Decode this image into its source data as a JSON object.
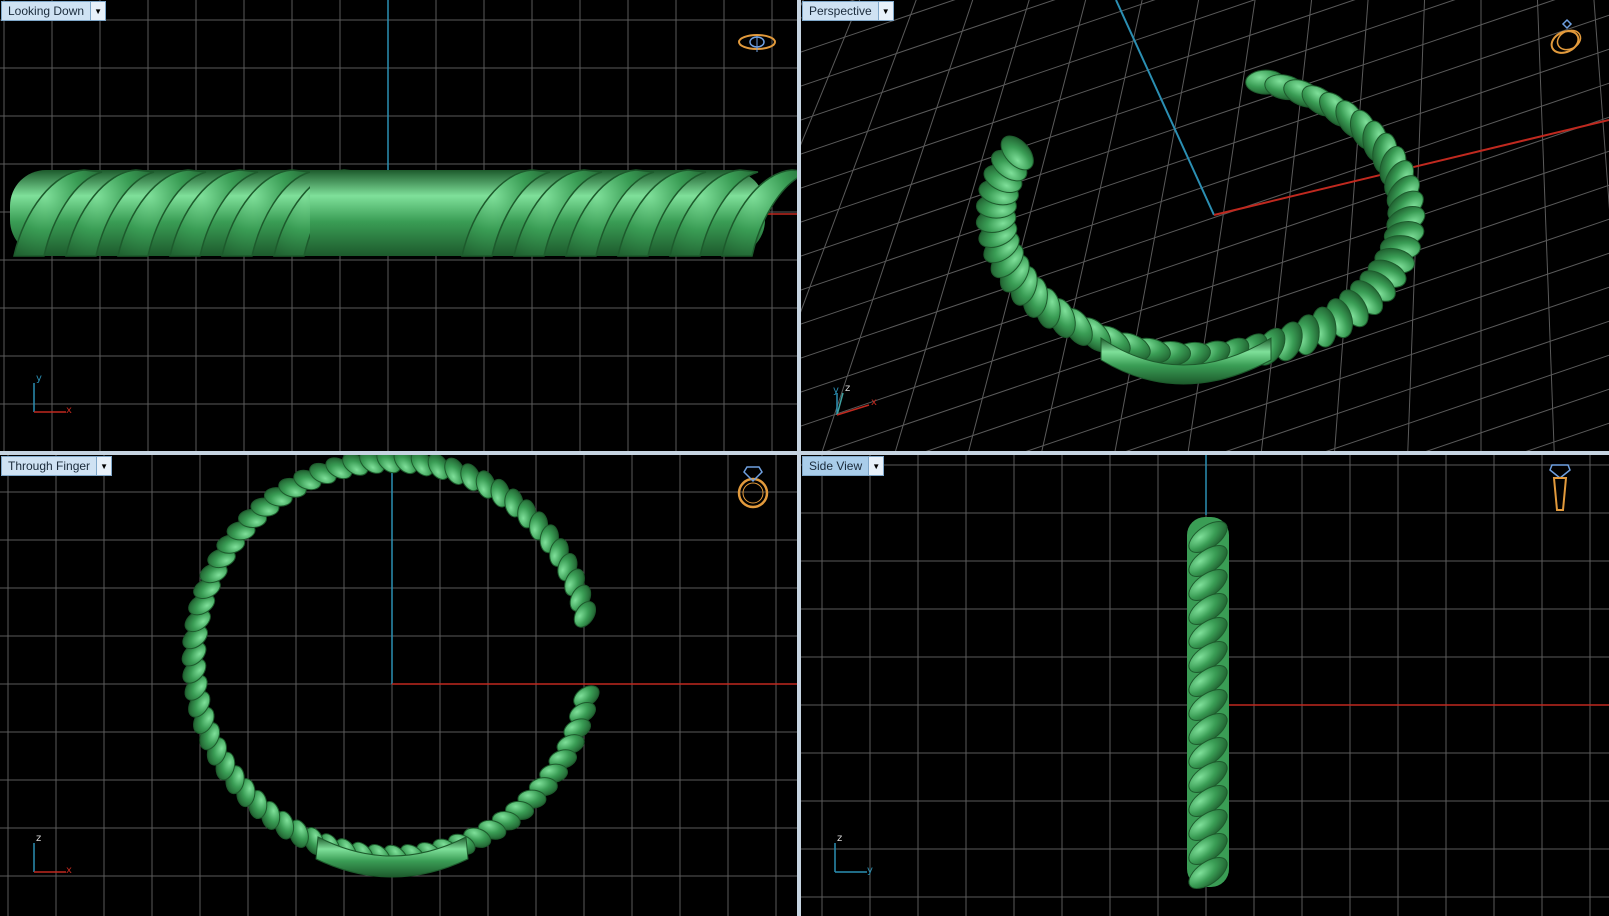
{
  "viewports": [
    {
      "id": "top",
      "label": "Looking Down",
      "axes": [
        "y",
        "x"
      ],
      "icon": "ring-top-view-icon"
    },
    {
      "id": "persp",
      "label": "Perspective",
      "axes": [
        "z",
        "y",
        "x"
      ],
      "icon": "ring-perspective-icon"
    },
    {
      "id": "front",
      "label": "Through Finger",
      "axes": [
        "z",
        "x"
      ],
      "icon": "ring-front-view-icon"
    },
    {
      "id": "side",
      "label": "Side View",
      "axes": [
        "z",
        "y"
      ],
      "icon": "ring-side-view-icon"
    }
  ],
  "colors": {
    "background": "#000000",
    "grid": "#5a5a5a",
    "axis_blue": "#2b8fb3",
    "axis_red": "#c0291f",
    "model_green": "#3a9d55",
    "model_highlight": "#7fe09a",
    "model_shadow": "#1d5a2c",
    "icon_orange": "#e29a3c",
    "label_bg": "#cfe2f3"
  }
}
